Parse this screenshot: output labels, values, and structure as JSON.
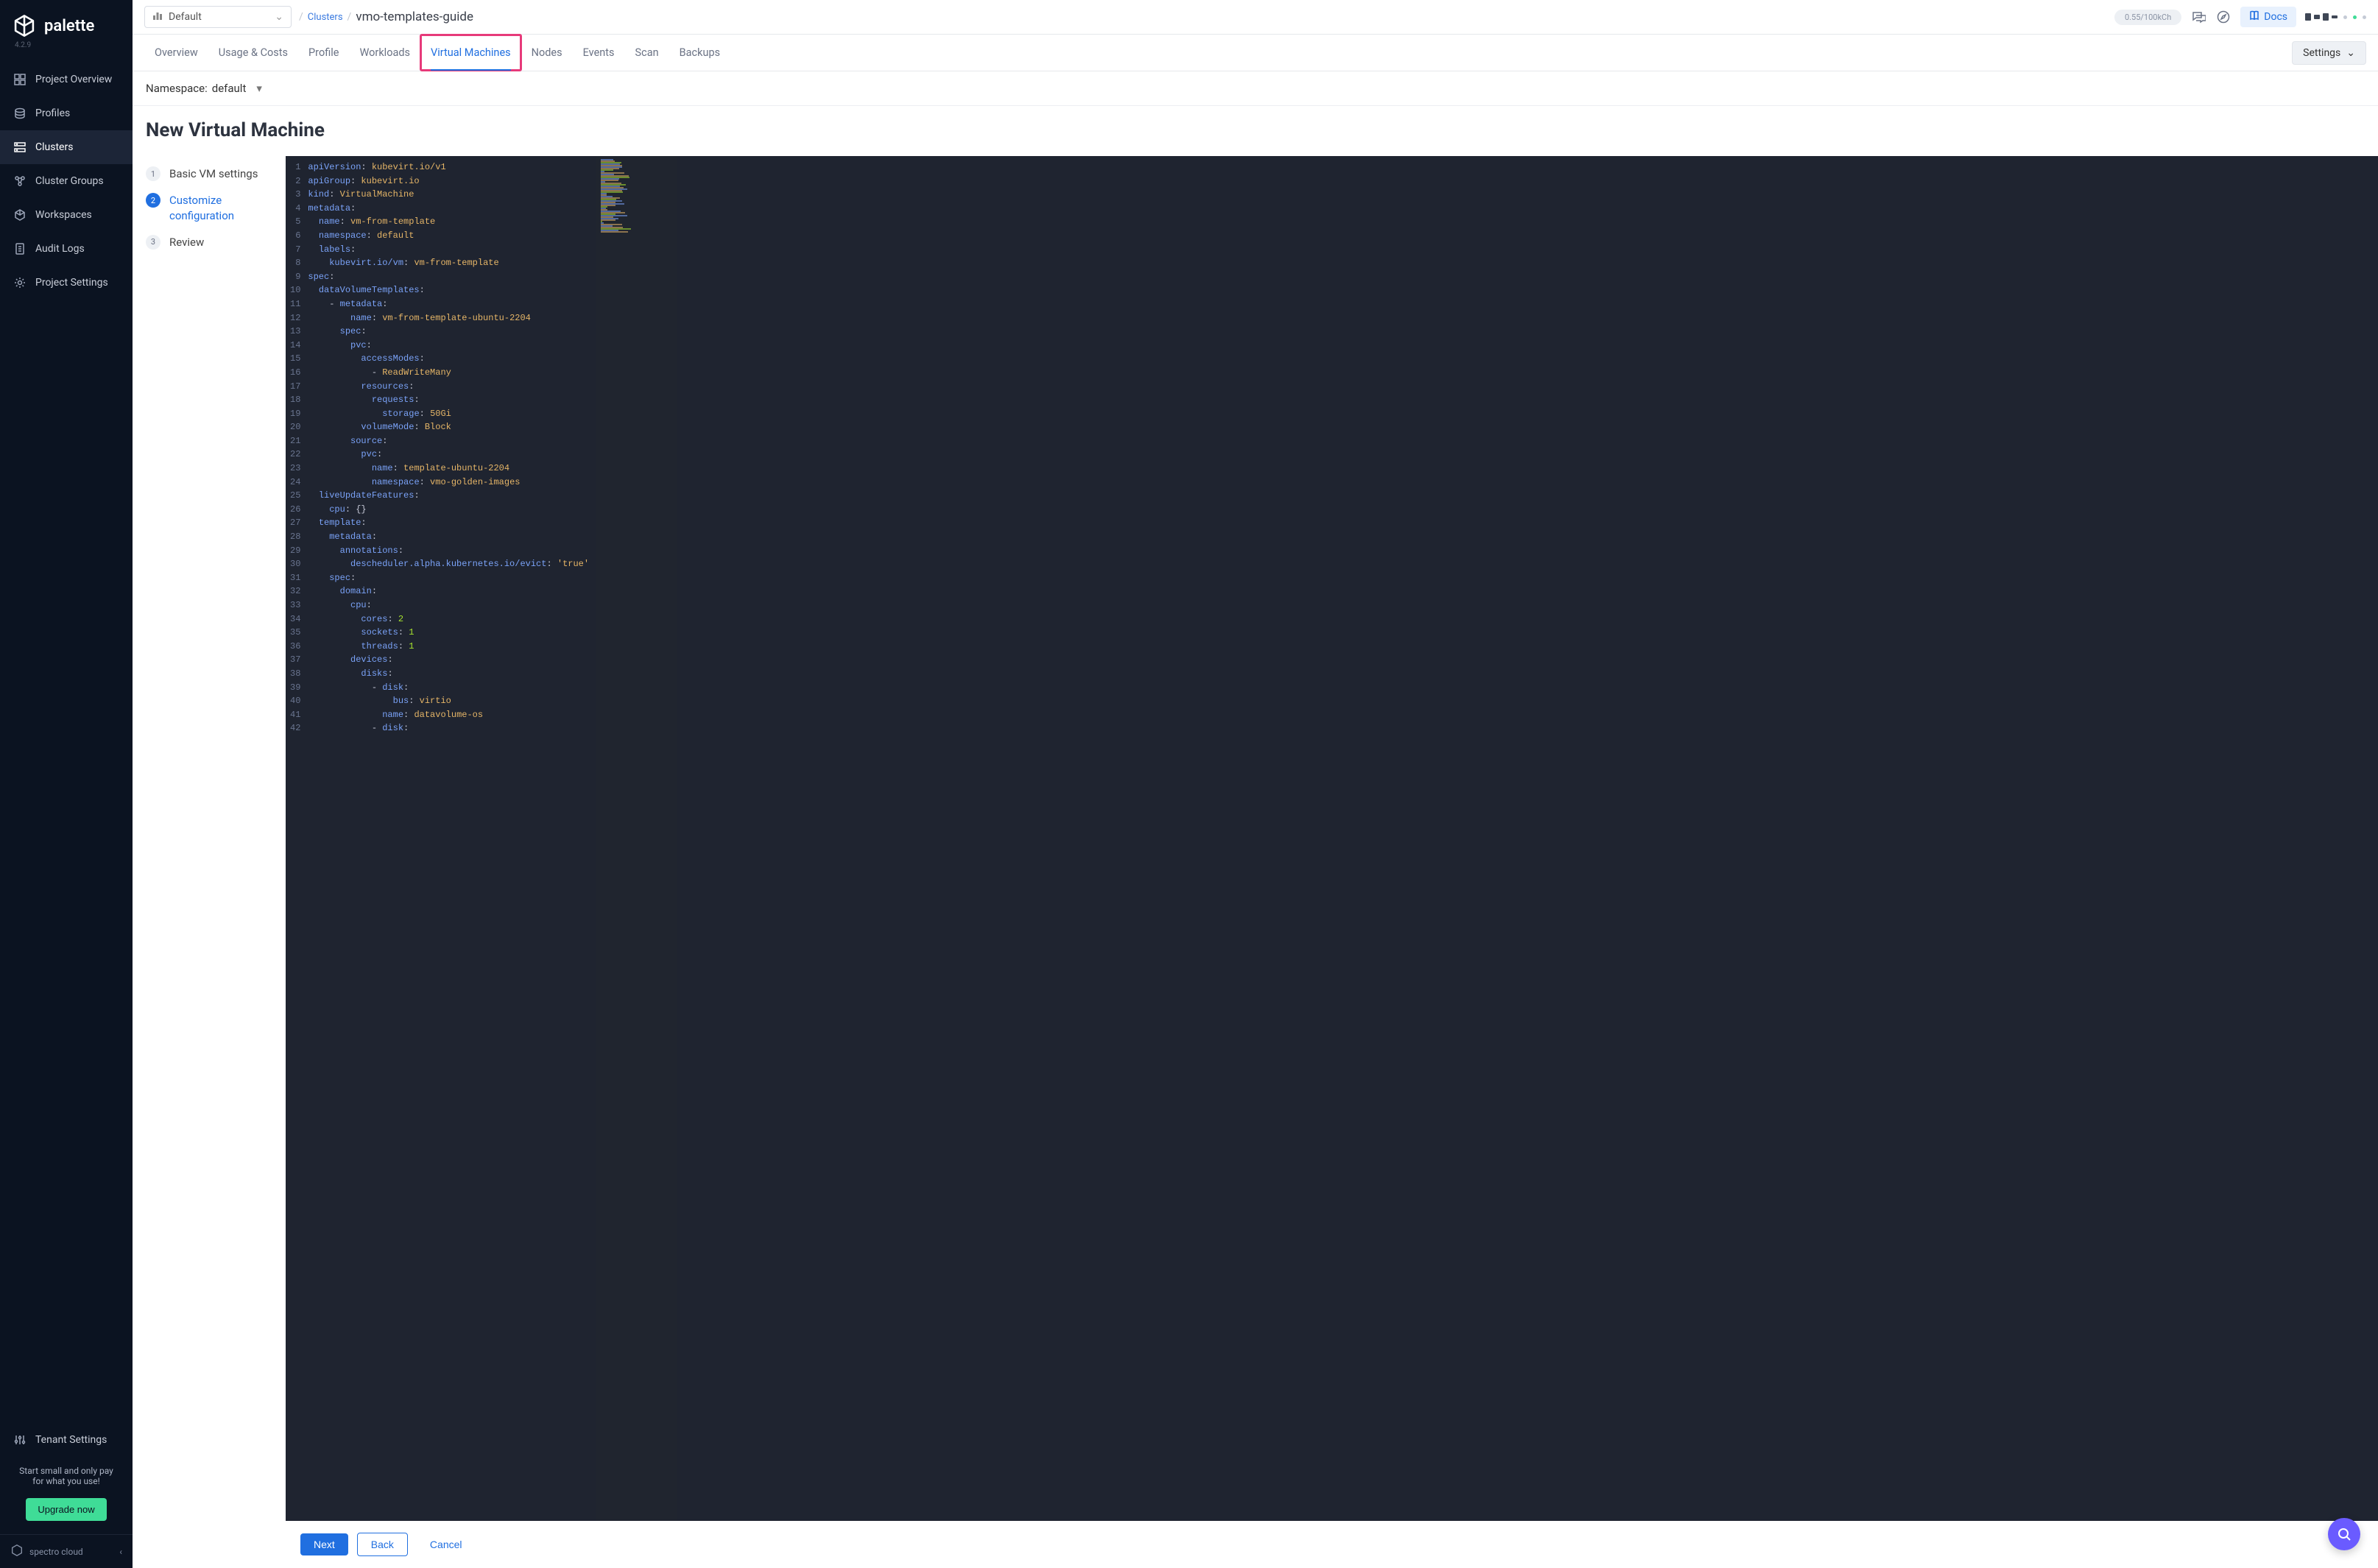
{
  "brand": {
    "name": "palette",
    "version": "4.2.9",
    "footer": "spectro cloud"
  },
  "sidebar": {
    "items": [
      {
        "label": "Project Overview"
      },
      {
        "label": "Profiles"
      },
      {
        "label": "Clusters"
      },
      {
        "label": "Cluster Groups"
      },
      {
        "label": "Workspaces"
      },
      {
        "label": "Audit Logs"
      },
      {
        "label": "Project Settings"
      }
    ],
    "tenant_settings": "Tenant Settings",
    "promo_line1": "Start small and only pay",
    "promo_line2": "for what you use!",
    "upgrade": "Upgrade now"
  },
  "topbar": {
    "tenant": "Default",
    "breadcrumb_parent": "Clusters",
    "breadcrumb_current": "vmo-templates-guide",
    "credits": "0.55/100kCh",
    "docs": "Docs"
  },
  "tabs": {
    "items": [
      "Overview",
      "Usage & Costs",
      "Profile",
      "Workloads",
      "Virtual Machines",
      "Nodes",
      "Events",
      "Scan",
      "Backups"
    ],
    "active_index": 4,
    "settings": "Settings"
  },
  "namespace": {
    "label": "Namespace: ",
    "value": "default"
  },
  "page": {
    "title": "New Virtual Machine"
  },
  "steps": {
    "items": [
      {
        "num": "1",
        "label": "Basic VM settings"
      },
      {
        "num": "2",
        "label": "Customize configuration"
      },
      {
        "num": "3",
        "label": "Review"
      }
    ],
    "active_index": 1
  },
  "actions": {
    "next": "Next",
    "back": "Back",
    "cancel": "Cancel"
  },
  "code": {
    "lines": [
      [
        [
          "k",
          "apiVersion"
        ],
        [
          "p",
          ": "
        ],
        [
          "s",
          "kubevirt.io/v1"
        ]
      ],
      [
        [
          "k",
          "apiGroup"
        ],
        [
          "p",
          ": "
        ],
        [
          "s",
          "kubevirt.io"
        ]
      ],
      [
        [
          "k",
          "kind"
        ],
        [
          "p",
          ": "
        ],
        [
          "s",
          "VirtualMachine"
        ]
      ],
      [
        [
          "k",
          "metadata"
        ],
        [
          "p",
          ":"
        ]
      ],
      [
        [
          "p",
          "  "
        ],
        [
          "k",
          "name"
        ],
        [
          "p",
          ": "
        ],
        [
          "s",
          "vm-from-template"
        ]
      ],
      [
        [
          "p",
          "  "
        ],
        [
          "k",
          "namespace"
        ],
        [
          "p",
          ": "
        ],
        [
          "s",
          "default"
        ]
      ],
      [
        [
          "p",
          "  "
        ],
        [
          "k",
          "labels"
        ],
        [
          "p",
          ":"
        ]
      ],
      [
        [
          "p",
          "    "
        ],
        [
          "k",
          "kubevirt.io/vm"
        ],
        [
          "p",
          ": "
        ],
        [
          "s",
          "vm-from-template"
        ]
      ],
      [
        [
          "k",
          "spec"
        ],
        [
          "p",
          ":"
        ]
      ],
      [
        [
          "p",
          "  "
        ],
        [
          "k",
          "dataVolumeTemplates"
        ],
        [
          "p",
          ":"
        ]
      ],
      [
        [
          "p",
          "    - "
        ],
        [
          "k",
          "metadata"
        ],
        [
          "p",
          ":"
        ]
      ],
      [
        [
          "p",
          "        "
        ],
        [
          "k",
          "name"
        ],
        [
          "p",
          ": "
        ],
        [
          "s",
          "vm-from-template-ubuntu-2204"
        ]
      ],
      [
        [
          "p",
          "      "
        ],
        [
          "k",
          "spec"
        ],
        [
          "p",
          ":"
        ]
      ],
      [
        [
          "p",
          "        "
        ],
        [
          "k",
          "pvc"
        ],
        [
          "p",
          ":"
        ]
      ],
      [
        [
          "p",
          "          "
        ],
        [
          "k",
          "accessModes"
        ],
        [
          "p",
          ":"
        ]
      ],
      [
        [
          "p",
          "            - "
        ],
        [
          "s",
          "ReadWriteMany"
        ]
      ],
      [
        [
          "p",
          "          "
        ],
        [
          "k",
          "resources"
        ],
        [
          "p",
          ":"
        ]
      ],
      [
        [
          "p",
          "            "
        ],
        [
          "k",
          "requests"
        ],
        [
          "p",
          ":"
        ]
      ],
      [
        [
          "p",
          "              "
        ],
        [
          "k",
          "storage"
        ],
        [
          "p",
          ": "
        ],
        [
          "s",
          "50Gi"
        ]
      ],
      [
        [
          "p",
          "          "
        ],
        [
          "k",
          "volumeMode"
        ],
        [
          "p",
          ": "
        ],
        [
          "s",
          "Block"
        ]
      ],
      [
        [
          "p",
          "        "
        ],
        [
          "k",
          "source"
        ],
        [
          "p",
          ":"
        ]
      ],
      [
        [
          "p",
          "          "
        ],
        [
          "k",
          "pvc"
        ],
        [
          "p",
          ":"
        ]
      ],
      [
        [
          "p",
          "            "
        ],
        [
          "k",
          "name"
        ],
        [
          "p",
          ": "
        ],
        [
          "s",
          "template-ubuntu-2204"
        ]
      ],
      [
        [
          "p",
          "            "
        ],
        [
          "k",
          "namespace"
        ],
        [
          "p",
          ": "
        ],
        [
          "s",
          "vmo-golden-images"
        ]
      ],
      [
        [
          "p",
          "  "
        ],
        [
          "k",
          "liveUpdateFeatures"
        ],
        [
          "p",
          ":"
        ]
      ],
      [
        [
          "p",
          "    "
        ],
        [
          "k",
          "cpu"
        ],
        [
          "p",
          ": "
        ],
        [
          "p",
          "{}"
        ]
      ],
      [
        [
          "p",
          "  "
        ],
        [
          "k",
          "template"
        ],
        [
          "p",
          ":"
        ]
      ],
      [
        [
          "p",
          "    "
        ],
        [
          "k",
          "metadata"
        ],
        [
          "p",
          ":"
        ]
      ],
      [
        [
          "p",
          "      "
        ],
        [
          "k",
          "annotations"
        ],
        [
          "p",
          ":"
        ]
      ],
      [
        [
          "p",
          "        "
        ],
        [
          "k",
          "descheduler.alpha.kubernetes.io/evict"
        ],
        [
          "p",
          ": "
        ],
        [
          "s",
          "'true'"
        ]
      ],
      [
        [
          "p",
          "    "
        ],
        [
          "k",
          "spec"
        ],
        [
          "p",
          ":"
        ]
      ],
      [
        [
          "p",
          "      "
        ],
        [
          "k",
          "domain"
        ],
        [
          "p",
          ":"
        ]
      ],
      [
        [
          "p",
          "        "
        ],
        [
          "k",
          "cpu"
        ],
        [
          "p",
          ":"
        ]
      ],
      [
        [
          "p",
          "          "
        ],
        [
          "k",
          "cores"
        ],
        [
          "p",
          ": "
        ],
        [
          "n",
          "2"
        ]
      ],
      [
        [
          "p",
          "          "
        ],
        [
          "k",
          "sockets"
        ],
        [
          "p",
          ": "
        ],
        [
          "n",
          "1"
        ]
      ],
      [
        [
          "p",
          "          "
        ],
        [
          "k",
          "threads"
        ],
        [
          "p",
          ": "
        ],
        [
          "n",
          "1"
        ]
      ],
      [
        [
          "p",
          "        "
        ],
        [
          "k",
          "devices"
        ],
        [
          "p",
          ":"
        ]
      ],
      [
        [
          "p",
          "          "
        ],
        [
          "k",
          "disks"
        ],
        [
          "p",
          ":"
        ]
      ],
      [
        [
          "p",
          "            - "
        ],
        [
          "k",
          "disk"
        ],
        [
          "p",
          ":"
        ]
      ],
      [
        [
          "p",
          "                "
        ],
        [
          "k",
          "bus"
        ],
        [
          "p",
          ": "
        ],
        [
          "s",
          "virtio"
        ]
      ],
      [
        [
          "p",
          "              "
        ],
        [
          "k",
          "name"
        ],
        [
          "p",
          ": "
        ],
        [
          "s",
          "datavolume-os"
        ]
      ],
      [
        [
          "p",
          "            - "
        ],
        [
          "k",
          "disk"
        ],
        [
          "p",
          ":"
        ]
      ]
    ]
  }
}
